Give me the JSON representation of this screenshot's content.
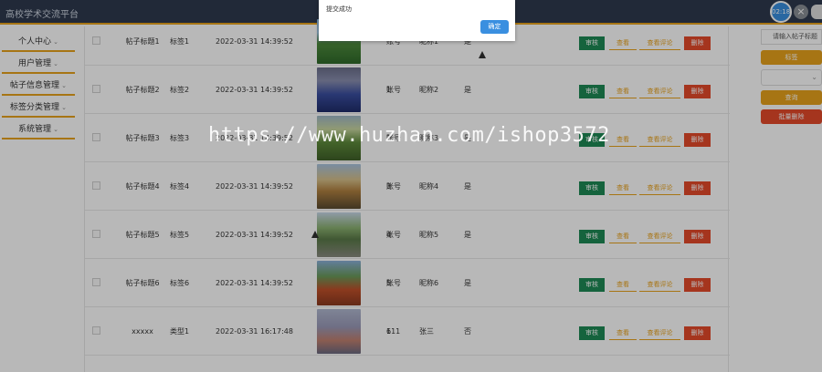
{
  "header": {
    "site_title": "高校学术交流平台",
    "clock": "02:18"
  },
  "sidebar": {
    "items": [
      {
        "label": "个人中心"
      },
      {
        "label": "用户管理"
      },
      {
        "label": "帖子信息管理"
      },
      {
        "label": "标签分类管理"
      },
      {
        "label": "系统管理"
      }
    ]
  },
  "table": {
    "rows": [
      {
        "title": "帖子标题1",
        "tag": "标签1",
        "date": "2022-03-31 14:39:52",
        "account": "账号1",
        "nickname": "昵称1",
        "flag": "是"
      },
      {
        "title": "帖子标题2",
        "tag": "标签2",
        "date": "2022-03-31 14:39:52",
        "account": "账号2",
        "nickname": "昵称2",
        "flag": "是"
      },
      {
        "title": "帖子标题3",
        "tag": "标签3",
        "date": "2022-03-31 14:39:52",
        "account": "账号3",
        "nickname": "昵称3",
        "flag": "是"
      },
      {
        "title": "帖子标题4",
        "tag": "标签4",
        "date": "2022-03-31 14:39:52",
        "account": "账号4",
        "nickname": "昵称4",
        "flag": "是"
      },
      {
        "title": "帖子标题5",
        "tag": "标签5",
        "date": "2022-03-31 14:39:52",
        "account": "账号5",
        "nickname": "昵称5",
        "flag": "是"
      },
      {
        "title": "帖子标题6",
        "tag": "标签6",
        "date": "2022-03-31 14:39:52",
        "account": "账号6",
        "nickname": "昵称6",
        "flag": "是"
      },
      {
        "title": "xxxxx",
        "tag": "类型1",
        "date": "2022-03-31 16:17:48",
        "account": "111",
        "nickname": "张三",
        "flag": "否"
      }
    ],
    "actions": {
      "audit": "审核",
      "view": "查看",
      "view_comments": "查看评论",
      "delete": "删除"
    }
  },
  "right_panel": {
    "search_placeholder": "请输入帖子标题",
    "tag_label": "标签",
    "query_button": "查询",
    "bulk_delete_button": "批量删除"
  },
  "dialog": {
    "message": "提交成功",
    "ok_button": "确定"
  },
  "watermark": "https://www.huzhan.com/ishop3572",
  "colors": {
    "header_bg": "#2e3a4e",
    "accent": "#e8a21c",
    "audit_green": "#1e8a55",
    "delete_red": "#e54a2a",
    "primary_blue": "#3a8fe0"
  }
}
